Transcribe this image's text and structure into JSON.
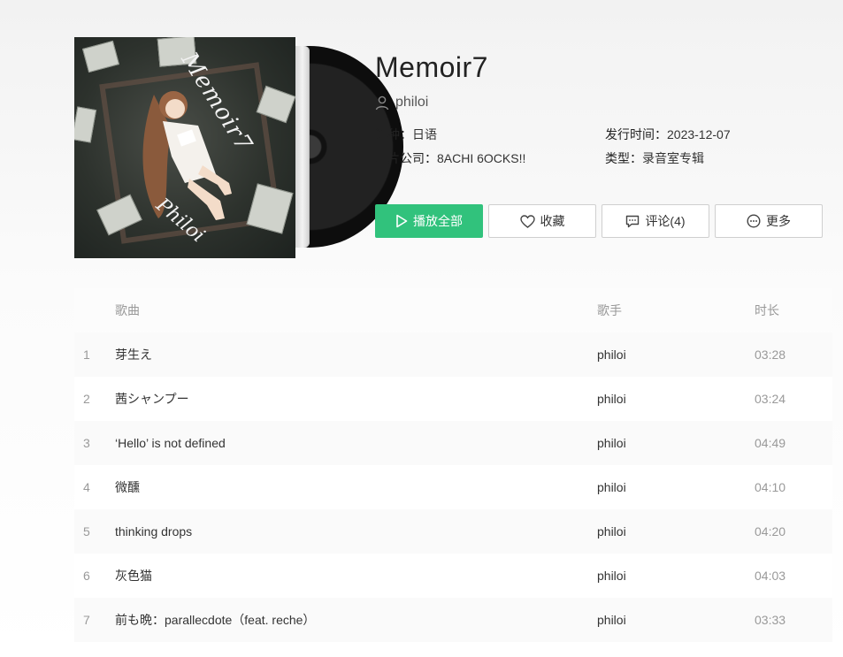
{
  "cover": {
    "title_text": "Memoir7",
    "artist_text": "Philoi"
  },
  "album": {
    "title": "Memoir7",
    "artist": "philoi",
    "language_label": "语种：",
    "language": "日语",
    "release_label": "发行时间：",
    "release_date": "2023-12-07",
    "company_label": "唱片公司：",
    "company": "8ACHI 6OCKS!!",
    "type_label": "类型：",
    "type": "录音室专辑"
  },
  "actions": {
    "play_all": "播放全部",
    "favorite": "收藏",
    "comment": "评论(4)",
    "more": "更多"
  },
  "icons": {
    "user": "user-icon",
    "play": "play-icon",
    "heart": "heart-icon",
    "comment": "comment-icon",
    "more": "more-icon"
  },
  "colors": {
    "accent": "#31c27c"
  },
  "table": {
    "headers": {
      "song": "歌曲",
      "singer": "歌手",
      "duration": "时长"
    },
    "rows": [
      {
        "idx": "1",
        "song": "芽生え",
        "singer": "philoi",
        "duration": "03:28"
      },
      {
        "idx": "2",
        "song": "茜シャンプー",
        "singer": "philoi",
        "duration": "03:24"
      },
      {
        "idx": "3",
        "song": "‘Hello’ is not defined",
        "singer": "philoi",
        "duration": "04:49"
      },
      {
        "idx": "4",
        "song": "微醺",
        "singer": "philoi",
        "duration": "04:10"
      },
      {
        "idx": "5",
        "song": "thinking drops",
        "singer": "philoi",
        "duration": "04:20"
      },
      {
        "idx": "6",
        "song": "灰色猫",
        "singer": "philoi",
        "duration": "04:03"
      },
      {
        "idx": "7",
        "song": "前も晩：parallecdote（feat. reche）",
        "singer": "philoi",
        "duration": "03:33"
      }
    ]
  }
}
